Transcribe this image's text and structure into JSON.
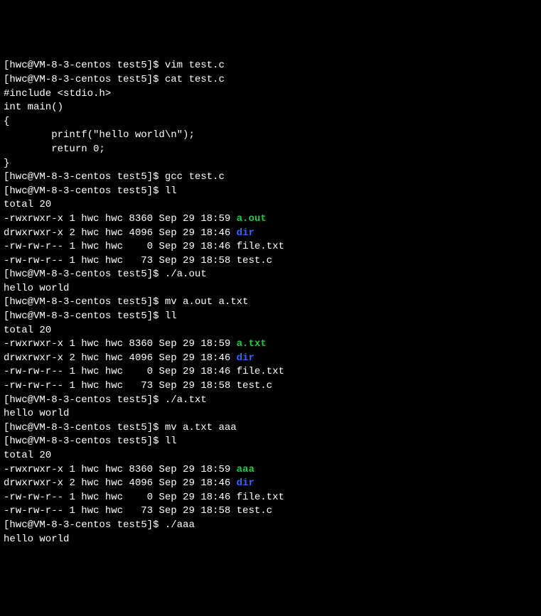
{
  "prompt": "[hwc@VM-8-3-centos test5]$ ",
  "lines": [
    {
      "type": "cmd",
      "text": "vim test.c"
    },
    {
      "type": "cmd",
      "text": "cat test.c"
    },
    {
      "type": "out",
      "text": "#include <stdio.h>"
    },
    {
      "type": "out",
      "text": "int main()"
    },
    {
      "type": "out",
      "text": "{"
    },
    {
      "type": "out",
      "text": ""
    },
    {
      "type": "out",
      "text": "        printf(\"hello world\\n\");"
    },
    {
      "type": "out",
      "text": "        return 0;"
    },
    {
      "type": "out",
      "text": "}"
    },
    {
      "type": "cmd",
      "text": "gcc test.c"
    },
    {
      "type": "cmd",
      "text": "ll"
    },
    {
      "type": "out",
      "text": "total 20"
    },
    {
      "type": "ls",
      "perm": "-rwxrwxr-x 1 hwc hwc 8360 Sep 29 18:59 ",
      "name": "a.out",
      "cls": "exec-green"
    },
    {
      "type": "ls",
      "perm": "drwxrwxr-x 2 hwc hwc 4096 Sep 29 18:46 ",
      "name": "dir",
      "cls": "dir-blue"
    },
    {
      "type": "ls",
      "perm": "-rw-rw-r-- 1 hwc hwc    0 Sep 29 18:46 ",
      "name": "file.txt",
      "cls": ""
    },
    {
      "type": "ls",
      "perm": "-rw-rw-r-- 1 hwc hwc   73 Sep 29 18:58 ",
      "name": "test.c",
      "cls": ""
    },
    {
      "type": "cmd",
      "text": "./a.out"
    },
    {
      "type": "out",
      "text": "hello world"
    },
    {
      "type": "cmd",
      "text": "mv a.out a.txt"
    },
    {
      "type": "cmd",
      "text": "ll"
    },
    {
      "type": "out",
      "text": "total 20"
    },
    {
      "type": "ls",
      "perm": "-rwxrwxr-x 1 hwc hwc 8360 Sep 29 18:59 ",
      "name": "a.txt",
      "cls": "exec-green"
    },
    {
      "type": "ls",
      "perm": "drwxrwxr-x 2 hwc hwc 4096 Sep 29 18:46 ",
      "name": "dir",
      "cls": "dir-blue"
    },
    {
      "type": "ls",
      "perm": "-rw-rw-r-- 1 hwc hwc    0 Sep 29 18:46 ",
      "name": "file.txt",
      "cls": ""
    },
    {
      "type": "ls",
      "perm": "-rw-rw-r-- 1 hwc hwc   73 Sep 29 18:58 ",
      "name": "test.c",
      "cls": ""
    },
    {
      "type": "cmd",
      "text": "./a.txt"
    },
    {
      "type": "out",
      "text": "hello world"
    },
    {
      "type": "cmd",
      "text": "mv a.txt aaa"
    },
    {
      "type": "cmd",
      "text": "ll"
    },
    {
      "type": "out",
      "text": "total 20"
    },
    {
      "type": "ls",
      "perm": "-rwxrwxr-x 1 hwc hwc 8360 Sep 29 18:59 ",
      "name": "aaa",
      "cls": "exec-green"
    },
    {
      "type": "ls",
      "perm": "drwxrwxr-x 2 hwc hwc 4096 Sep 29 18:46 ",
      "name": "dir",
      "cls": "dir-blue"
    },
    {
      "type": "ls",
      "perm": "-rw-rw-r-- 1 hwc hwc    0 Sep 29 18:46 ",
      "name": "file.txt",
      "cls": ""
    },
    {
      "type": "ls",
      "perm": "-rw-rw-r-- 1 hwc hwc   73 Sep 29 18:58 ",
      "name": "test.c",
      "cls": ""
    },
    {
      "type": "cmd",
      "text": "./aaa"
    },
    {
      "type": "out",
      "text": "hello world"
    }
  ]
}
